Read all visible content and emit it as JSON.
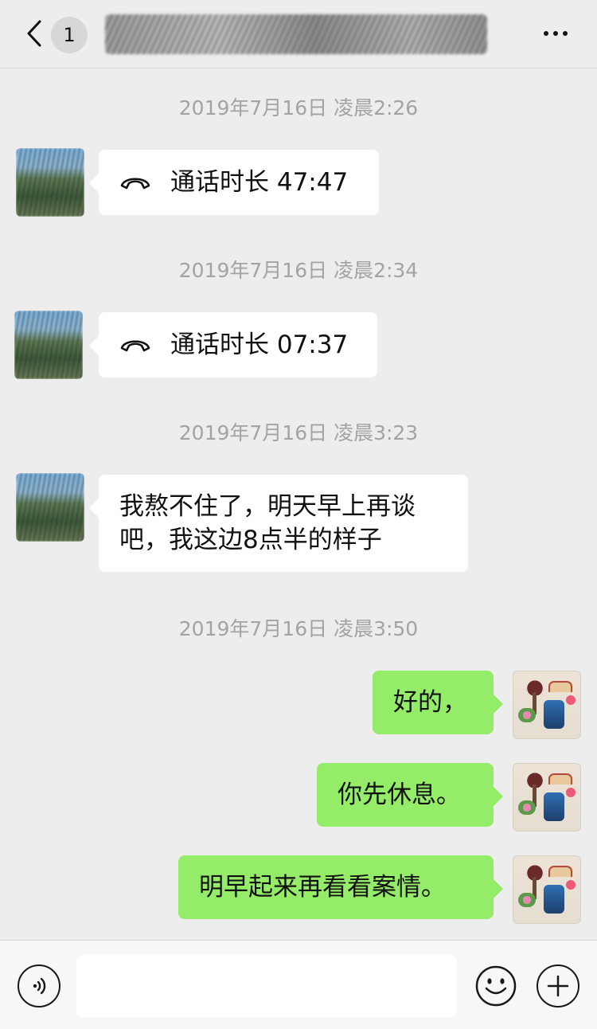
{
  "header": {
    "unread_count": "1",
    "back_icon": "chevron-left-icon",
    "more_icon": "more-dots-icon"
  },
  "messages": [
    {
      "timestamp": "2019年7月16日 凌晨2:26",
      "side": "left",
      "kind": "call",
      "icon": "phone-hangup-icon",
      "text": "通话时长 47:47"
    },
    {
      "timestamp": "2019年7月16日 凌晨2:34",
      "side": "left",
      "kind": "call",
      "icon": "phone-hangup-icon",
      "text": "通话时长 07:37"
    },
    {
      "timestamp": "2019年7月16日 凌晨3:23",
      "side": "left",
      "kind": "text",
      "lines": [
        "我熬不住了，明天早上再谈",
        "吧，我这边8点半的样子"
      ]
    },
    {
      "timestamp": "2019年7月16日 凌晨3:50",
      "side": "right",
      "kind": "text",
      "text": "好的，"
    },
    {
      "side": "right",
      "kind": "text",
      "text": "你先休息。"
    },
    {
      "side": "right",
      "kind": "text",
      "text": "明早起来再看看案情。"
    }
  ],
  "input_bar": {
    "voice_icon": "voice-icon",
    "emoji_icon": "emoji-icon",
    "plus_icon": "plus-icon",
    "input_value": ""
  },
  "colors": {
    "background": "#ededed",
    "incoming_bubble": "#ffffff",
    "outgoing_bubble": "#95ec69",
    "timestamp": "#a3a3a3"
  }
}
